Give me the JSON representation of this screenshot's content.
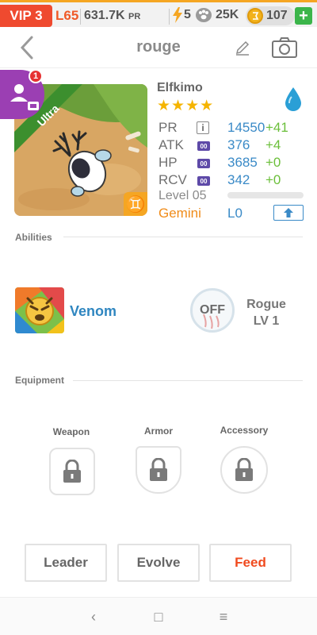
{
  "status_bar": {
    "vip": "VIP 3",
    "level": "L65",
    "power_value": "631.7K",
    "power_unit": "PR",
    "energy": "5",
    "food": "25K",
    "coins": "107",
    "add_label": "+"
  },
  "header": {
    "title": "rouge"
  },
  "notification": {
    "count": "1"
  },
  "card": {
    "rarity": "Ultra"
  },
  "profile": {
    "name": "Elfkimo",
    "stars": "★★★★",
    "stats": [
      {
        "label": "PR",
        "value": "14550",
        "delta": "+41"
      },
      {
        "label": "ATK",
        "value": "376",
        "delta": "+4"
      },
      {
        "label": "HP",
        "value": "3685",
        "delta": "+0"
      },
      {
        "label": "RCV",
        "value": "342",
        "delta": "+0"
      }
    ],
    "stat_icon_text": "00",
    "info_icon_text": "i",
    "level_label": "Level 05",
    "level_progress": 0,
    "sign": "Gemini",
    "sign_glyph": "♊",
    "level_code": "L0"
  },
  "abilities": {
    "title": "Abilities",
    "skill_name": "Venom",
    "toggle_label": "OFF",
    "class_name": "Rogue",
    "class_level": "LV 1"
  },
  "equipment": {
    "title": "Equipment",
    "slots": [
      {
        "label": "Weapon"
      },
      {
        "label": "Armor"
      },
      {
        "label": "Accessory"
      }
    ]
  },
  "actions": {
    "leader": "Leader",
    "evolve": "Evolve",
    "feed": "Feed"
  },
  "nav": {
    "back": "‹",
    "home": "□",
    "menu": "≡"
  },
  "colors": {
    "accent_orange": "#f05a28",
    "link_blue": "#3a8ac7",
    "positive_green": "#6bbf3a",
    "feed_red": "#f04a1e",
    "stars": "#f5b400"
  }
}
